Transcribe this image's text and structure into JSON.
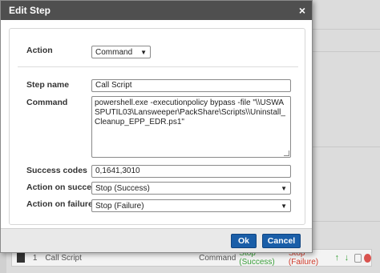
{
  "dialog": {
    "title": "Edit Step",
    "close_glyph": "×"
  },
  "form": {
    "action_label": "Action",
    "action_value": "Command",
    "step_name_label": "Step name",
    "step_name_value": "Call Script",
    "command_label": "Command",
    "command_value": "powershell.exe -executionpolicy bypass -file \"\\\\USWASPUTIL03\\Lansweeper\\PackShare\\Scripts\\\\Uninstall_Cleanup_EPP_EDR.ps1\"",
    "success_codes_label": "Success codes",
    "success_codes_value": "0,1641,3010",
    "action_on_success_label": "Action on success",
    "action_on_success_value": "Stop (Success)",
    "action_on_failure_label": "Action on failure",
    "action_on_failure_value": "Stop (Failure)"
  },
  "buttons": {
    "ok": "Ok",
    "cancel": "Cancel"
  },
  "background_row": {
    "number": "1",
    "name": "Call Script",
    "type": "Command",
    "on_success": "Stop (Success)",
    "on_failure": "Stop (Failure)"
  },
  "colors": {
    "titlebar": "#4f4f4f",
    "primary_button": "#1a5ea8",
    "success_text": "#3aa03a",
    "failure_text": "#d03a2a"
  }
}
